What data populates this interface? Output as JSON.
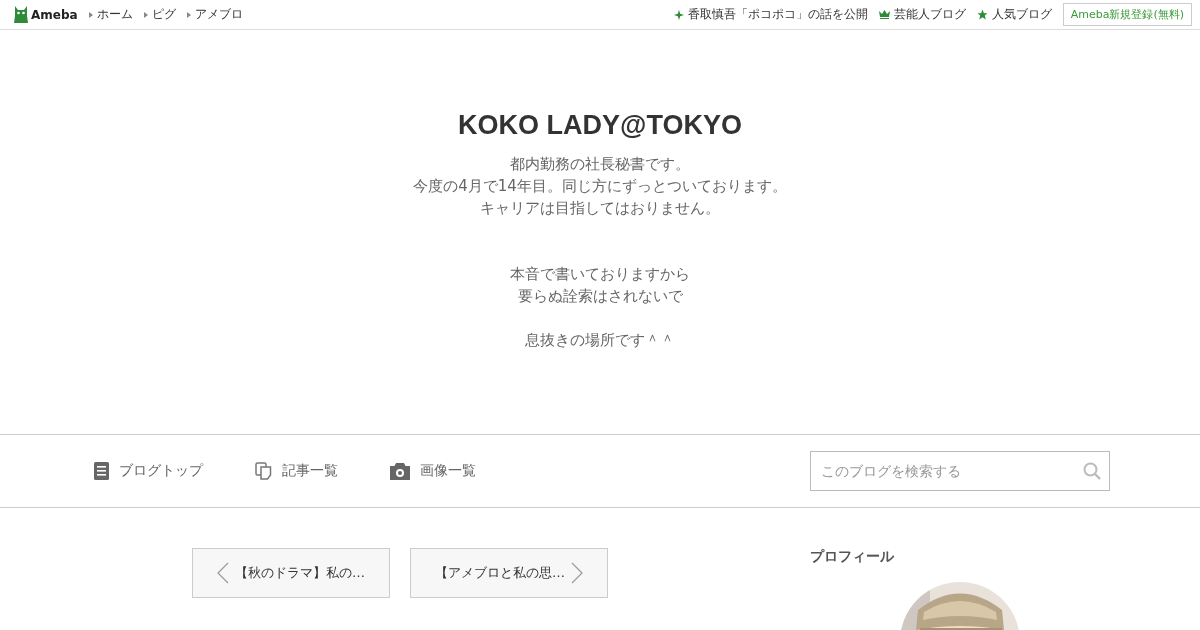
{
  "topbar": {
    "logo": "Ameba",
    "nav": [
      "ホーム",
      "ピグ",
      "アメブロ"
    ],
    "links": [
      {
        "kind": "sparkle",
        "label": "香取慎吾「ポコポコ」の話を公開"
      },
      {
        "kind": "crown",
        "label": "芸能人ブログ"
      },
      {
        "kind": "star",
        "label": "人気ブログ"
      }
    ],
    "register": "Ameba新規登録(無料)"
  },
  "blog": {
    "title": "KOKO LADY@TOKYO",
    "description": [
      [
        "都内勤務の社長秘書です。",
        "今度の4月で14年目。同じ方にずっとついております。",
        "キャリアは目指してはおりません。"
      ],
      [
        "本音で書いておりますから",
        "要らぬ詮索はされないで"
      ],
      [
        "息抜きの場所です＾＾"
      ]
    ]
  },
  "menu": [
    {
      "kind": "document",
      "label": "ブログトップ"
    },
    {
      "kind": "copy",
      "label": "記事一覧"
    },
    {
      "kind": "camera",
      "label": "画像一覧"
    }
  ],
  "search": {
    "placeholder": "このブログを検索する"
  },
  "pager": {
    "prev": "【秋のドラマ】私の…",
    "next": "【アメブロと私の思…"
  },
  "sidebar": {
    "heading": "プロフィール"
  }
}
